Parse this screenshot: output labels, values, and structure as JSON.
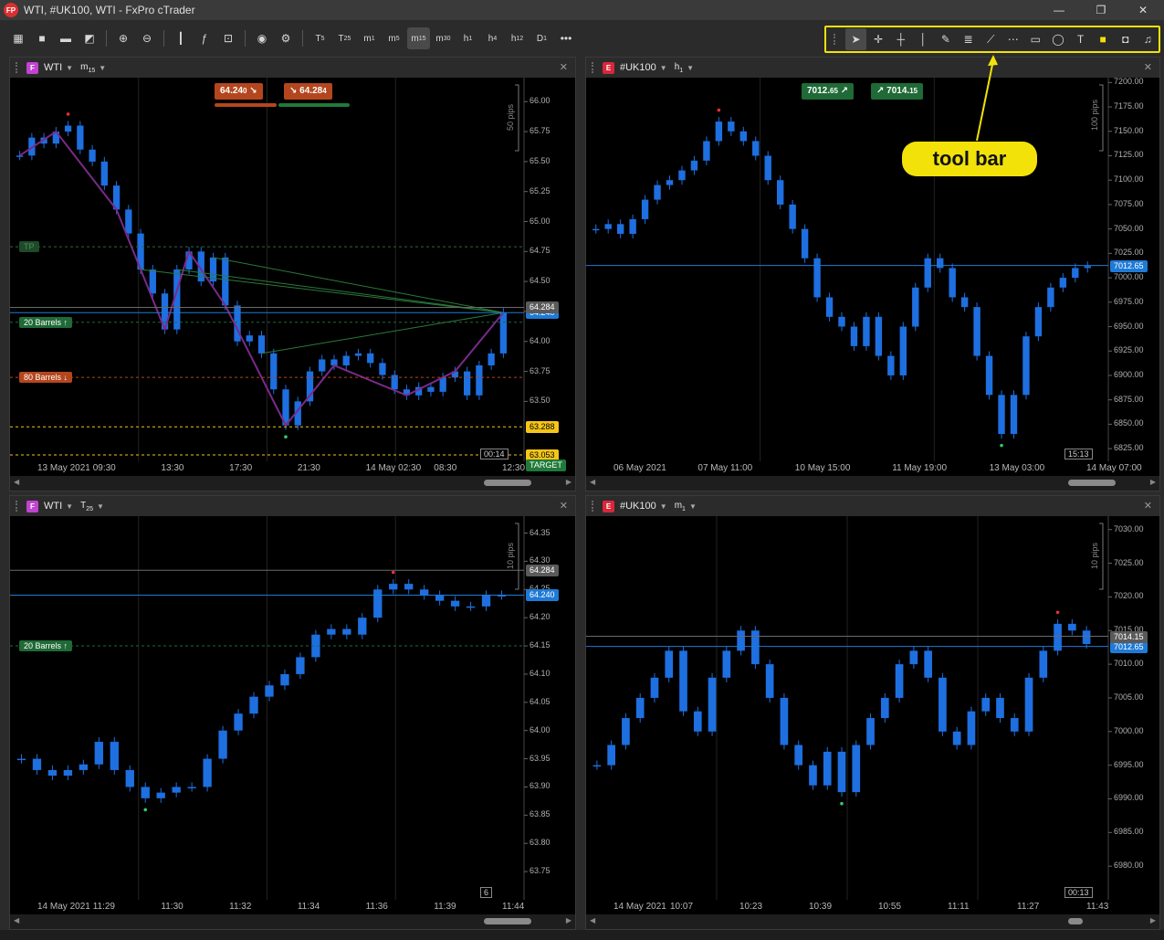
{
  "window": {
    "title": "WTI, #UK100, WTI - FxPro cTrader",
    "logo": "FP",
    "controls": [
      "—",
      "❐",
      "✕"
    ]
  },
  "toolbar": {
    "left_icons": [
      "layout-icon",
      "single-chart-icon",
      "multi-chart-icon",
      "chart-type-icon",
      "zoom-in-icon",
      "zoom-out-icon",
      "candle-icon",
      "indicator-icon",
      "cbot-icon",
      "eye-icon",
      "settings-icon"
    ],
    "timeframes": [
      {
        "base": "T",
        "sub": "5"
      },
      {
        "base": "T",
        "sub": "25"
      },
      {
        "base": "m",
        "sub": "1"
      },
      {
        "base": "m",
        "sub": "5"
      },
      {
        "base": "m",
        "sub": "15"
      },
      {
        "base": "m",
        "sub": "30"
      },
      {
        "base": "h",
        "sub": "1"
      },
      {
        "base": "h",
        "sub": "4"
      },
      {
        "base": "h",
        "sub": "12"
      },
      {
        "base": "D",
        "sub": "1"
      }
    ],
    "active_timeframe_index": 4,
    "more": "•••"
  },
  "drawing_toolbar": {
    "tools": [
      "pointer",
      "crosshair",
      "horizontal-line",
      "vertical-line",
      "pen",
      "fibonacci",
      "trend",
      "grid",
      "rectangle",
      "ellipse",
      "text",
      "color",
      "camera",
      "alarm"
    ]
  },
  "callout": {
    "text": "tool bar"
  },
  "charts": [
    {
      "id": "wti-m15",
      "symbol": "WTI",
      "badge": "F",
      "badge_color": "#c044d0",
      "tf_base": "m",
      "tf_sub": "15",
      "trade": {
        "sell": "64.24",
        "sell_sup": "0",
        "buy": "64.28",
        "buy_sup": "4"
      },
      "pips_scale": "50 pips",
      "y_labels": [
        "66.00",
        "65.75",
        "65.50",
        "65.25",
        "65.00",
        "64.75",
        "64.50",
        "64.25",
        "64.00",
        "63.75",
        "63.50"
      ],
      "y_range": [
        63.0,
        66.2
      ],
      "x_labels": [
        "13 May 2021",
        "09:30",
        "13:30",
        "17:30",
        "21:30",
        "14 May 02:30",
        "08:30",
        "12:30"
      ],
      "bid_tag": "64.240",
      "ask_tag": "64.284",
      "tags": [
        {
          "text": "63.288",
          "value": 63.288,
          "color": "#f5c518",
          "fg": "#000"
        },
        {
          "text": "63.053",
          "value": 63.053,
          "color": "#f5c518",
          "fg": "#000"
        },
        {
          "text": "TARGET",
          "value": 62.97,
          "color": "#1f7a3a",
          "fg": "#fff"
        }
      ],
      "orders": [
        {
          "text": "TP",
          "value": 64.79,
          "color": "#1e4a2a",
          "fg": "#4c8c5c"
        },
        {
          "text": "20 Barrels ↑",
          "value": 64.16,
          "color": "#1f6a36",
          "fg": "#fff"
        },
        {
          "text": "80 Barrels ↓",
          "value": 63.7,
          "color": "#b4461e",
          "fg": "#fff"
        }
      ],
      "timer": "00:14",
      "series": [
        65.55,
        65.7,
        65.65,
        65.75,
        65.8,
        65.6,
        65.5,
        65.3,
        65.1,
        64.9,
        64.6,
        64.4,
        64.1,
        64.6,
        64.75,
        64.5,
        64.7,
        64.3,
        64.0,
        64.05,
        63.9,
        63.6,
        63.3,
        63.5,
        63.75,
        63.85,
        63.8,
        63.88,
        63.9,
        63.82,
        63.72,
        63.6,
        63.55,
        63.62,
        63.58,
        63.7,
        63.75,
        63.55,
        63.8,
        63.9,
        64.24
      ]
    },
    {
      "id": "uk100-h1",
      "symbol": "#UK100",
      "badge": "E",
      "badge_color": "#d9263a",
      "tf_base": "h",
      "tf_sub": "1",
      "trade": {
        "sell": "7012.",
        "sell_sup": "65",
        "buy": "7014.",
        "buy_sup": "15"
      },
      "pips_scale": "100 pips",
      "y_labels": [
        "7200.00",
        "7175.00",
        "7150.00",
        "7125.00",
        "7100.00",
        "7075.00",
        "7050.00",
        "7025.00",
        "7000.00",
        "6975.00",
        "6950.00",
        "6925.00",
        "6900.00",
        "6875.00",
        "6850.00",
        "6825.00"
      ],
      "y_range": [
        6812,
        7205
      ],
      "x_labels": [
        "06 May 2021",
        "07 May 11:00",
        "10 May 15:00",
        "11 May 19:00",
        "13 May 03:00",
        "14 May 07:00"
      ],
      "bid_tag": "7012.65",
      "timer": "15:13",
      "series": [
        7050,
        7055,
        7045,
        7060,
        7080,
        7095,
        7100,
        7110,
        7120,
        7140,
        7160,
        7150,
        7140,
        7125,
        7100,
        7075,
        7050,
        7020,
        6980,
        6960,
        6950,
        6930,
        6960,
        6920,
        6900,
        6950,
        6990,
        7020,
        7010,
        6980,
        6970,
        6920,
        6880,
        6840,
        6880,
        6940,
        6970,
        6990,
        7000,
        7010,
        7012
      ]
    },
    {
      "id": "wti-t25",
      "symbol": "WTI",
      "badge": "F",
      "badge_color": "#c044d0",
      "tf_base": "T",
      "tf_sub": "25",
      "pips_scale": "10 pips",
      "y_labels": [
        "64.35",
        "64.30",
        "64.25",
        "64.20",
        "64.15",
        "64.10",
        "64.05",
        "64.00",
        "63.95",
        "63.90",
        "63.85",
        "63.80",
        "63.75"
      ],
      "y_range": [
        63.7,
        64.38
      ],
      "x_labels": [
        "14 May 2021",
        "11:29",
        "11:30",
        "11:32",
        "11:34",
        "11:36",
        "11:39",
        "11:44"
      ],
      "bid_tag": "64.240",
      "ask_tag": "64.284",
      "orders": [
        {
          "text": "20 Barrels ↑",
          "value": 64.15,
          "color": "#1f6a36",
          "fg": "#fff"
        }
      ],
      "timer": "6",
      "series": [
        63.95,
        63.93,
        63.92,
        63.93,
        63.94,
        63.98,
        63.93,
        63.9,
        63.88,
        63.89,
        63.9,
        63.9,
        63.95,
        64.0,
        64.03,
        64.06,
        64.08,
        64.1,
        64.13,
        64.17,
        64.18,
        64.17,
        64.2,
        64.25,
        64.26,
        64.25,
        64.24,
        64.23,
        64.22,
        64.22,
        64.24,
        64.24
      ]
    },
    {
      "id": "uk100-m1",
      "symbol": "#UK100",
      "badge": "E",
      "badge_color": "#d9263a",
      "tf_base": "m",
      "tf_sub": "1",
      "pips_scale": "10 pips",
      "y_labels": [
        "7030.00",
        "7025.00",
        "7020.00",
        "7015.00",
        "7010.00",
        "7005.00",
        "7000.00",
        "6995.00",
        "6990.00",
        "6985.00",
        "6980.00"
      ],
      "y_range": [
        6975,
        7032
      ],
      "x_labels": [
        "14 May 2021",
        "10:07",
        "10:23",
        "10:39",
        "10:55",
        "11:11",
        "11:27",
        "11:43"
      ],
      "bid_tag": "7012.65",
      "ask_tag": "7014.15",
      "timer": "00:13",
      "series": [
        6995,
        6998,
        7002,
        7005,
        7008,
        7012,
        7003,
        7000,
        7008,
        7012,
        7015,
        7010,
        7005,
        6998,
        6995,
        6992,
        6997,
        6991,
        6998,
        7002,
        7005,
        7010,
        7012,
        7008,
        7000,
        6998,
        7003,
        7005,
        7002,
        7000,
        7008,
        7012,
        7016,
        7015,
        7013
      ]
    }
  ],
  "colors": {
    "candle": "#1e6fe0",
    "bid_line": "#1f7ad6",
    "ask_line": "#6a6a6a",
    "yellow": "#f2e20a"
  }
}
